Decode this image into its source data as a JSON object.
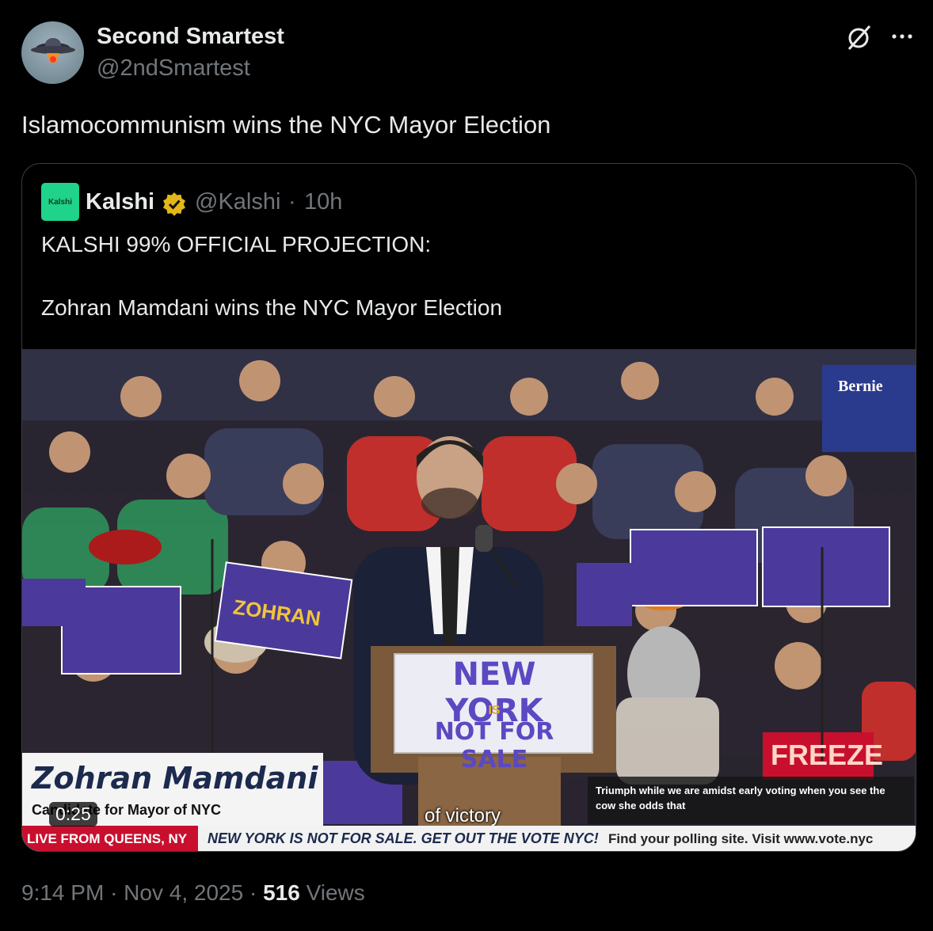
{
  "author": {
    "name": "Second Smartest",
    "handle": "@2ndSmartest"
  },
  "tweet": {
    "text": "Islamocommunism wins the NYC Mayor Election"
  },
  "quoted": {
    "logo_text": "Kalshi",
    "name": "Kalshi",
    "handle": "@Kalshi",
    "separator": "·",
    "time": "10h",
    "line1": "KALSHI 99% OFFICIAL PROJECTION:",
    "line2": "Zohran Mamdani wins the NYC Mayor Election",
    "video": {
      "duration": "0:25",
      "lower_third_name": "Zohran Mamdani",
      "lower_third_role": "Candidate for Mayor of NYC",
      "subtitle": "of victory",
      "caption": "Triumph while we are amidst early voting when you see the cow she odds that",
      "ticker_live": "LIVE FROM QUEENS, NY",
      "ticker_message": "NEW YORK IS NOT FOR SALE. GET OUT THE VOTE NYC!",
      "ticker_polling": "Find your polling site. Visit www.vote.nyc",
      "podium_sign_top": "NEW YORK",
      "podium_sign_mid": "IS",
      "podium_sign_bottom": "NOT FOR SALE",
      "crowd_sign": "ZOHRAN",
      "corner_sign": "Bernie",
      "freeze_sign": "FREEZE"
    }
  },
  "meta": {
    "time": "9:14 PM",
    "sep1": "·",
    "date": "Nov 4, 2025",
    "sep2": "·",
    "views_count": "516",
    "views_label": "Views"
  },
  "colors": {
    "background": "#000000",
    "text_primary": "#e7e9ea",
    "text_secondary": "#71767b",
    "kalshi_green": "#1fd38a",
    "verified_gold": "#e2b719",
    "ticker_red": "#c8102e"
  }
}
